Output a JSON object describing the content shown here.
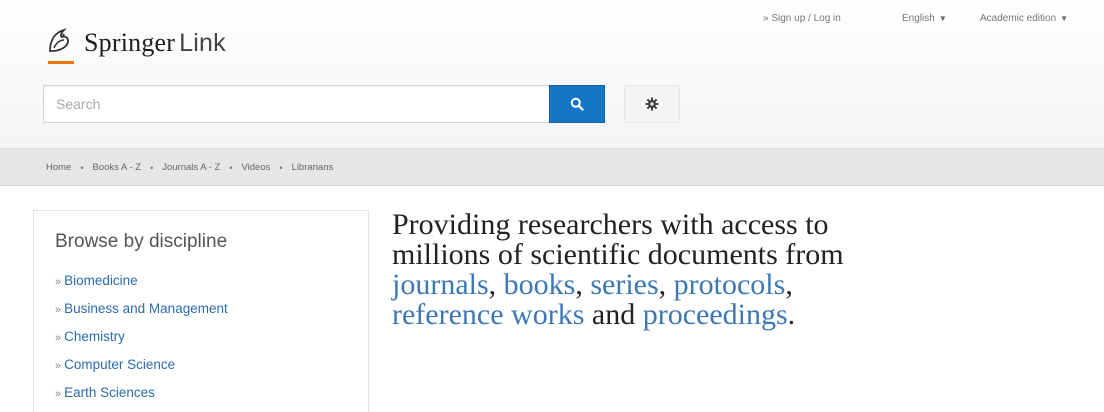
{
  "brand": {
    "name": "Springer",
    "suffix": "Link",
    "accent": "#e8750f"
  },
  "top_links": {
    "signup": "» Sign up / Log in",
    "language": "English",
    "edition": "Academic edition"
  },
  "search": {
    "placeholder": "Search",
    "button_color": "#1676c4"
  },
  "nav": [
    "Home",
    "Books A - Z",
    "Journals A - Z",
    "Videos",
    "Librarians"
  ],
  "sidebar": {
    "title": "Browse by discipline",
    "items": [
      "Biomedicine",
      "Business and Management",
      "Chemistry",
      "Computer Science",
      "Earth Sciences"
    ],
    "item_prefix": "»"
  },
  "hero": {
    "line1": "Providing researchers with access to",
    "line2": "millions of scientific documents from",
    "links": [
      "journals",
      "books",
      "series",
      "protocols",
      "reference works",
      "proceedings"
    ],
    "and": "and",
    "period": ".",
    "link_color": "#3d78b3"
  }
}
